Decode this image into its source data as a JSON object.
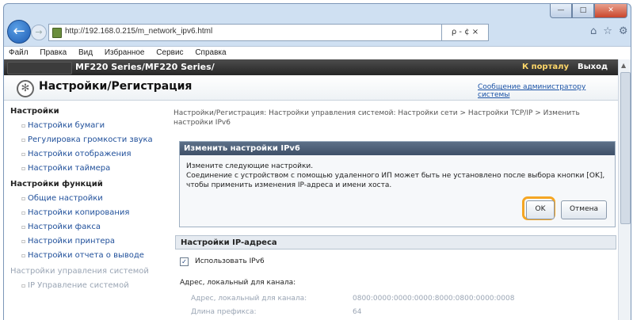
{
  "browser": {
    "url": "http://192.168.0.215/m_network_ipv6.html",
    "addr_tools": "ρ - ¢ ×",
    "menu": [
      "Файл",
      "Правка",
      "Вид",
      "Избранное",
      "Сервис",
      "Справка"
    ]
  },
  "device": {
    "title": "MF220 Series/MF220 Series/",
    "portal_link": "К порталу",
    "logout_link": "Выход"
  },
  "header": {
    "title": "Настройки/Регистрация",
    "admin_link": "Сообщение администратору системы"
  },
  "sidebar": {
    "groups": [
      {
        "label": "Настройки",
        "items": [
          "Настройки бумаги",
          "Регулировка громкости звука",
          "Настройки отображения",
          "Настройки таймера"
        ]
      },
      {
        "label": "Настройки функций",
        "items": [
          "Общие настройки",
          "Настройки копирования",
          "Настройки факса",
          "Настройки принтера",
          "Настройки отчета о выводе"
        ]
      },
      {
        "label": "Настройки управления системой",
        "items": [
          "IP Управление системой"
        ]
      }
    ]
  },
  "content": {
    "breadcrumb": "Настройки/Регистрация: Настройки управления системой: Настройки сети > Настройки TCP/IP > Изменить настройки IPv6",
    "confirm": {
      "title": "Изменить настройки IPv6",
      "line1": "Измените следующие настройки.",
      "line2": "Соединение с устройством с помощью удаленного ИП может быть не установлено после выбора кнопки [OK],",
      "line3": "чтобы применить изменения IP-адреса и имени хоста.",
      "ok": "OK",
      "cancel": "Отмена"
    },
    "ip_settings": {
      "title": "Настройки IP-адреса",
      "use_ipv6_label": "Использовать IPv6",
      "use_ipv6_checked": true,
      "link_local_heading": "Адрес, локальный для канала:",
      "link_local_label": "Адрес, локальный для канала:",
      "link_local_value": "0800:0000:0000:0000:8000:0800:0000:0008",
      "prefix_label": "Длина префикса:",
      "prefix_value": "64"
    }
  },
  "colors": {
    "accent_highlight": "#f5a623",
    "link": "#1f4f9a",
    "device_bar": "#2f2f2f"
  }
}
